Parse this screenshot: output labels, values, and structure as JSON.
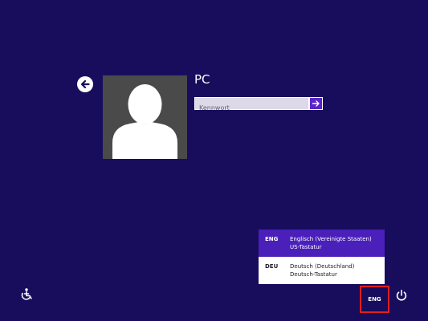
{
  "user": {
    "name": "PC"
  },
  "password": {
    "placeholder": "Kennwort",
    "value": ""
  },
  "icons": {
    "back": "back-arrow-icon",
    "avatar": "user-silhouette-icon",
    "submit": "right-arrow-icon",
    "power": "power-icon",
    "ease_of_access": "ease-of-access-icon"
  },
  "language_menu": {
    "options": [
      {
        "code": "ENG",
        "name": "Englisch (Vereinigte Staaten)",
        "keyboard": "US-Tastatur",
        "selected": true
      },
      {
        "code": "DEU",
        "name": "Deutsch (Deutschland)",
        "keyboard": "Deutsch-Tastatur",
        "selected": false
      }
    ]
  },
  "language_indicator": {
    "label": "ENG"
  },
  "colors": {
    "background": "#180d5c",
    "accent": "#4a1fba",
    "highlight_border": "#e01e1e"
  }
}
